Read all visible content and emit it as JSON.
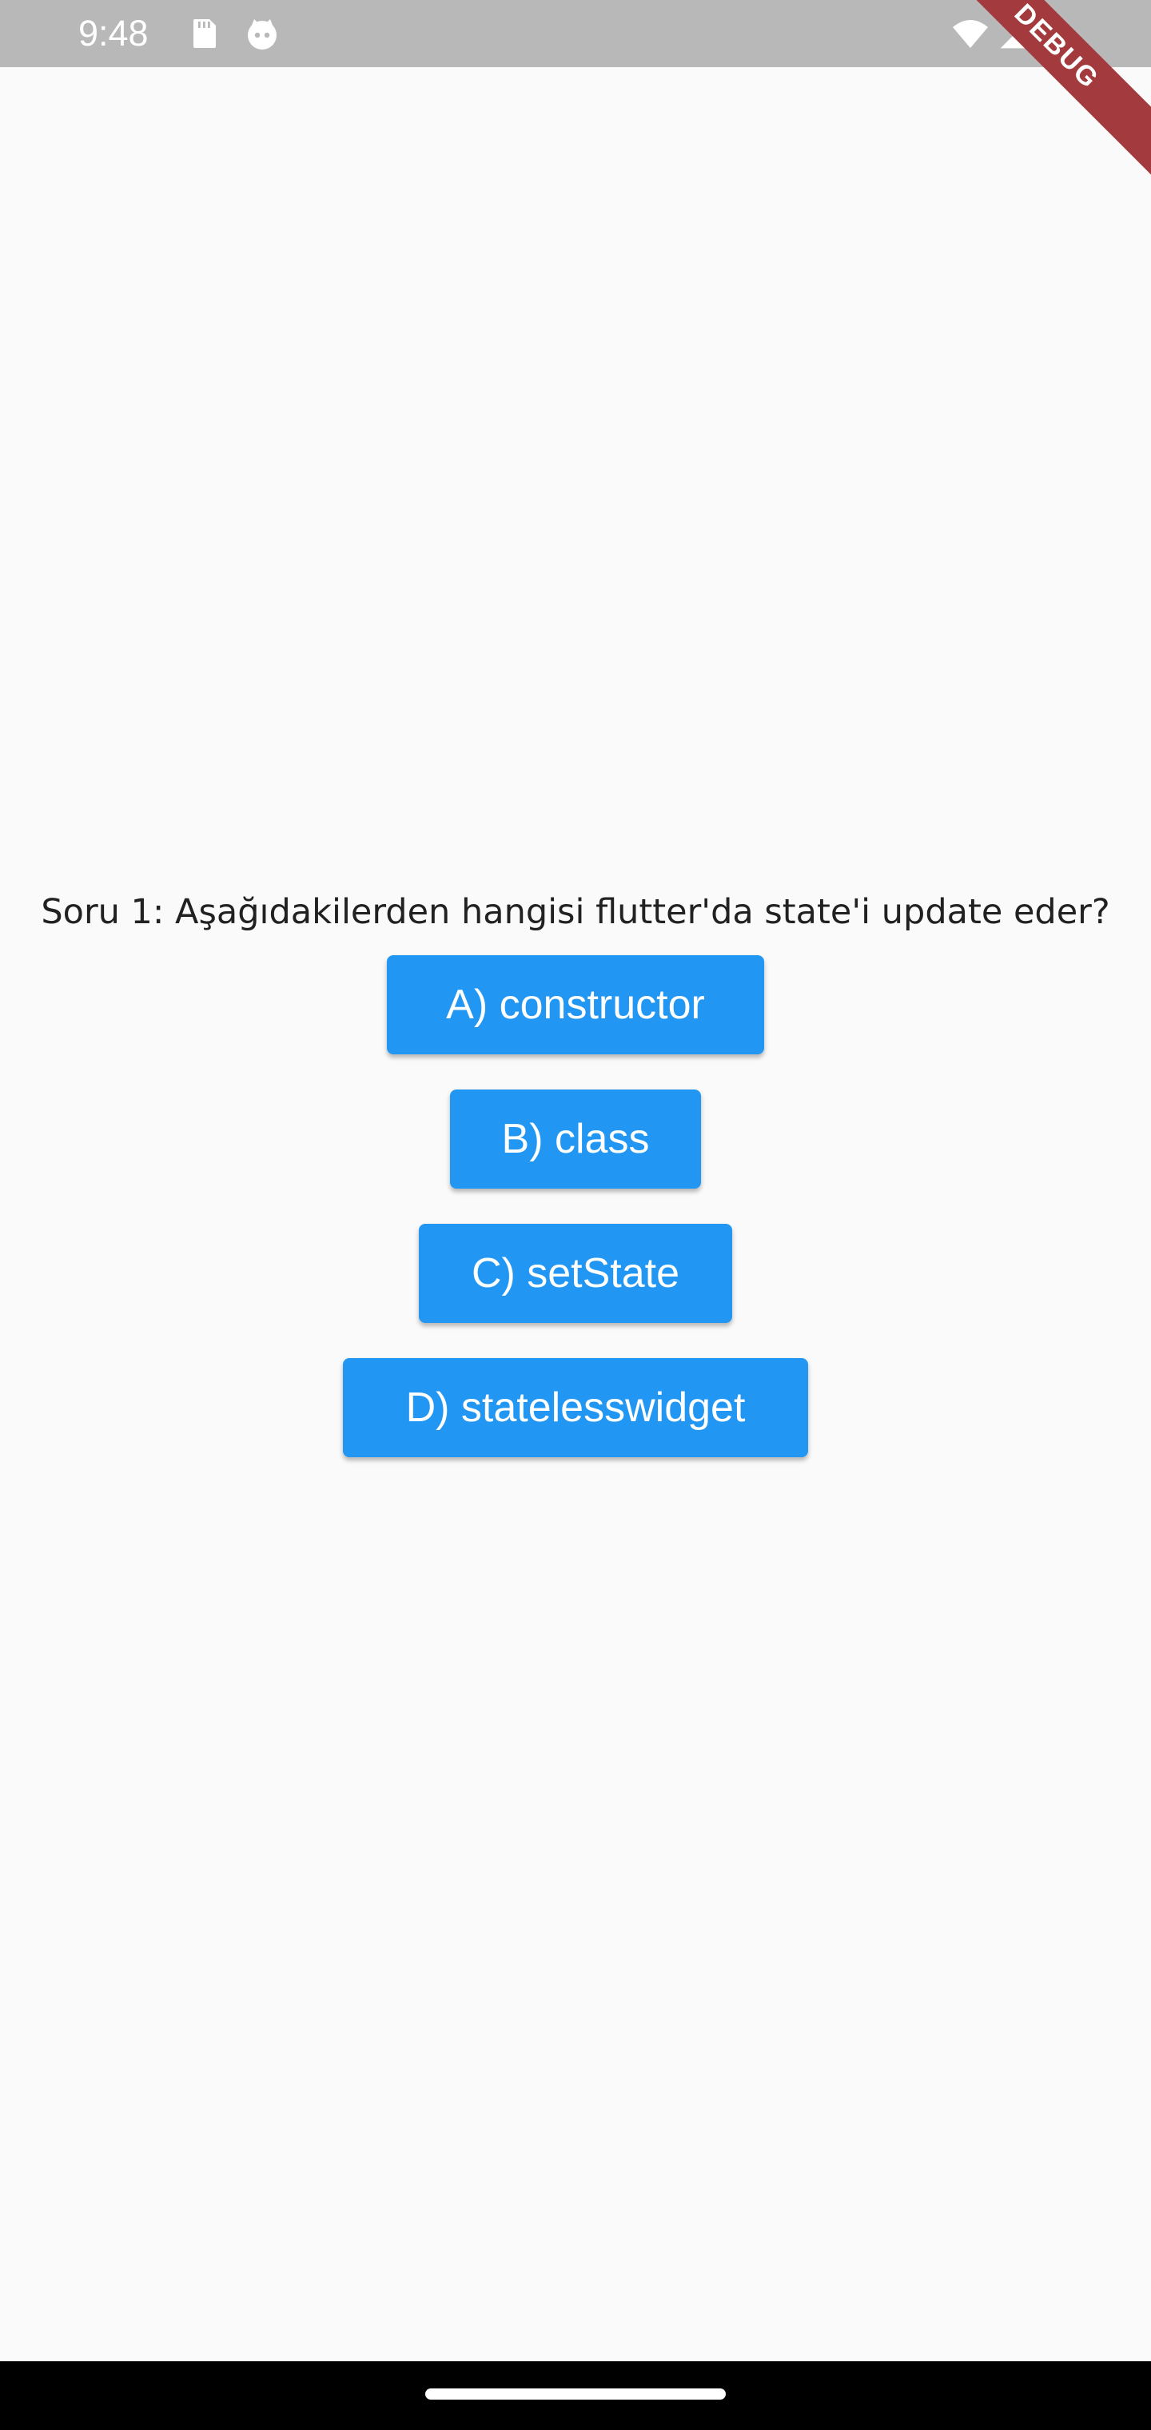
{
  "status_bar": {
    "time": "9:48",
    "left_icons": [
      "sd-card-icon",
      "notification-face-icon"
    ],
    "right_icons": [
      "wifi-icon",
      "cell-signal-icon"
    ]
  },
  "debug_banner": {
    "label": "DEBUG",
    "color": "#a33a3d"
  },
  "quiz": {
    "question": "Soru 1: Aşağıdakilerden hangisi flutter'da state'i update eder?",
    "answers": [
      {
        "label": "A) constructor"
      },
      {
        "label": "B) class"
      },
      {
        "label": "C) setState"
      },
      {
        "label": "D) statelesswidget"
      }
    ]
  },
  "colors": {
    "button": "#2196f3",
    "background": "#fafafa",
    "status_bar": "#b8b8b8",
    "nav_bar": "#000000"
  }
}
